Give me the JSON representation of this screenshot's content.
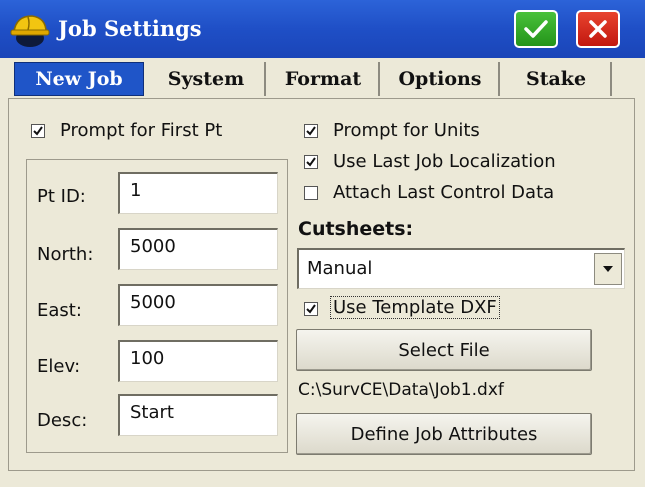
{
  "window": {
    "title": "Job Settings"
  },
  "tabs": [
    {
      "label": "New Job",
      "active": true
    },
    {
      "label": "System"
    },
    {
      "label": "Format"
    },
    {
      "label": "Options"
    },
    {
      "label": "Stake"
    }
  ],
  "left": {
    "prompt_first_pt": {
      "label": "Prompt for First Pt",
      "checked": true
    },
    "fields": [
      {
        "label": "Pt ID:",
        "value": "1"
      },
      {
        "label": "North:",
        "value": "5000"
      },
      {
        "label": "East:",
        "value": "5000"
      },
      {
        "label": "Elev:",
        "value": "100"
      },
      {
        "label": "Desc:",
        "value": "Start"
      }
    ]
  },
  "right": {
    "prompt_units": {
      "label": "Prompt for Units",
      "checked": true
    },
    "use_last_localization": {
      "label": "Use Last Job Localization",
      "checked": true
    },
    "attach_control": {
      "label": "Attach Last Control Data",
      "checked": false
    },
    "cutsheets_heading": "Cutsheets:",
    "cutsheets_value": "Manual",
    "use_template_dxf": {
      "label": "Use Template DXF",
      "checked": true
    },
    "select_file_label": "Select File",
    "file_path": "C:\\SurvCE\\Data\\Job1.dxf",
    "define_attributes_label": "Define Job Attributes"
  },
  "colors": {
    "titlebar": "#1f4fc6",
    "active_tab": "#1f55c8",
    "ok": "#24941a",
    "close": "#c2170f",
    "background": "#ece9d8"
  },
  "icons": [
    "hard-hat-icon",
    "checkmark-icon",
    "close-icon",
    "checkbox-check-icon",
    "dropdown-arrow-icon"
  ]
}
